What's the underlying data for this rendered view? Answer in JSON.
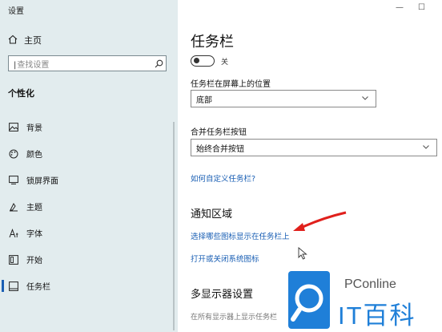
{
  "window": {
    "title": "设置",
    "minimize": "—",
    "maximize": "☐"
  },
  "sidebar": {
    "home_label": "主页",
    "search_placeholder": "查找设置",
    "section_title": "个性化",
    "items": [
      {
        "label": "背景",
        "icon": "image-icon"
      },
      {
        "label": "颜色",
        "icon": "palette-icon"
      },
      {
        "label": "锁屏界面",
        "icon": "lock-screen-icon"
      },
      {
        "label": "主题",
        "icon": "theme-icon"
      },
      {
        "label": "字体",
        "icon": "font-icon"
      },
      {
        "label": "开始",
        "icon": "start-icon"
      },
      {
        "label": "任务栏",
        "icon": "taskbar-icon",
        "active": true
      }
    ]
  },
  "main": {
    "title": "任务栏",
    "toggle_label": "关",
    "toggle_on": false,
    "position_label": "任务栏在屏幕上的位置",
    "position_value": "底部",
    "combine_label": "合并任务栏按钮",
    "combine_value": "始终合并按钮",
    "customize_link": "如何自定义任务栏?",
    "notification_heading": "通知区域",
    "select_icons_link": "选择哪些图标显示在任务栏上",
    "system_icons_link": "打开或关闭系统图标",
    "multi_display_heading": "多显示器设置",
    "multi_display_partial": "在所有显示器上显示任务栏"
  },
  "watermark": {
    "brand": "PConline",
    "name": "IT百科"
  },
  "colors": {
    "sidebar_bg": "#e2ecee",
    "link": "#1a5fb4",
    "arrow": "#e0201c",
    "brand": "#1f7fd8"
  }
}
